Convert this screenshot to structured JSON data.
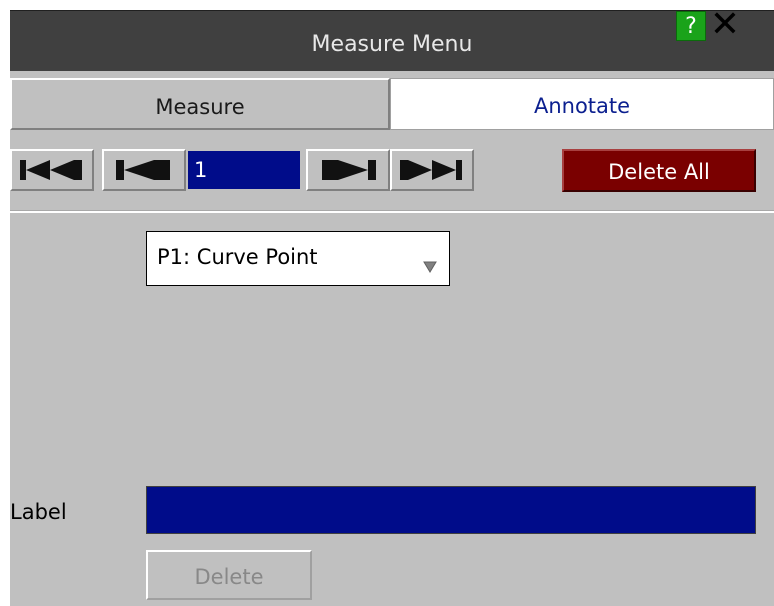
{
  "window": {
    "title": "Measure Menu",
    "help_label": "?",
    "close_label": "✕"
  },
  "tabs": [
    {
      "label": "Measure",
      "active": false
    },
    {
      "label": "Annotate",
      "active": true
    }
  ],
  "navigation": {
    "current_record": "1",
    "delete_all_label": "Delete All",
    "buttons": [
      "first-icon",
      "previous-icon",
      "next-icon",
      "last-icon"
    ]
  },
  "annotation": {
    "point_type_selected": "P1: Curve Point",
    "label_caption": "Label",
    "label_value": "",
    "delete_label": "Delete"
  },
  "colors": {
    "title_bar": "#404040",
    "panel": "#c0c0c0",
    "field_blue": "#000c8a",
    "delete_all_red": "#7a0000",
    "annotate_text": "#0b1f8f",
    "help_green": "#1aa31a"
  }
}
